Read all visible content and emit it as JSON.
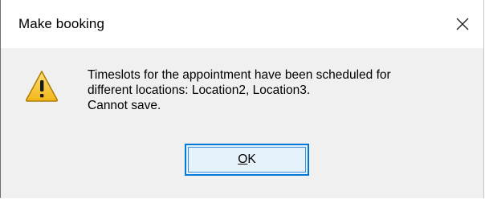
{
  "window": {
    "title": "Make booking",
    "close_icon": "close-icon"
  },
  "message": {
    "icon": "warning-icon",
    "lines": [
      "Timeslots for the appointment have been scheduled for",
      "different locations: Location2, Location3.",
      "Cannot save."
    ]
  },
  "buttons": {
    "ok_mnemonic": "O",
    "ok_rest": "K"
  },
  "colors": {
    "accent": "#0078d7",
    "button_fill": "#e5f1fb",
    "warning_fill": "#f7c640"
  }
}
